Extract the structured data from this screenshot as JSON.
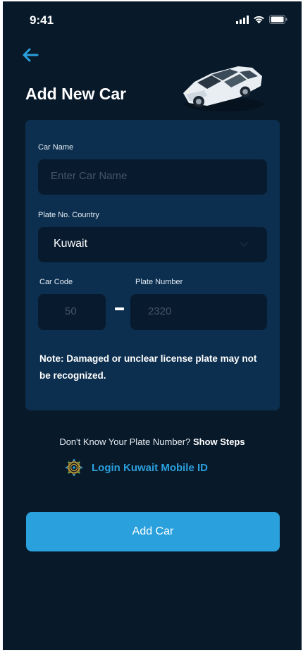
{
  "status_bar": {
    "time": "9:41",
    "icons": [
      "signal-icon",
      "wifi-icon",
      "battery-icon"
    ]
  },
  "header": {
    "back_icon": "arrow-left-icon",
    "title": "Add New Car",
    "illustration": "car-illustration"
  },
  "form": {
    "car_name": {
      "label": "Car Name",
      "placeholder": "Enter Car Name",
      "value": ""
    },
    "plate_country": {
      "label": "Plate No. Country",
      "value": "Kuwait",
      "icon": "chevron-down-icon"
    },
    "car_code": {
      "label": "Car Code",
      "placeholder": "50"
    },
    "plate_number": {
      "label": "Plate Number",
      "placeholder": "2320"
    },
    "note": "Note: Damaged or unclear license plate may not be recognized."
  },
  "help": {
    "prompt": "Don't Know Your  Plate Number?",
    "link": "Show Steps",
    "mobile_id_label": "Login Kuwait Mobile ID",
    "mobile_id_icon": "kuwait-mobile-id-icon"
  },
  "actions": {
    "add_car_label": "Add Car"
  },
  "colors": {
    "background": "#08192a",
    "card": "#0c2f4f",
    "field": "#081a2d",
    "accent": "#2aa0dc",
    "placeholder": "#46566a"
  }
}
